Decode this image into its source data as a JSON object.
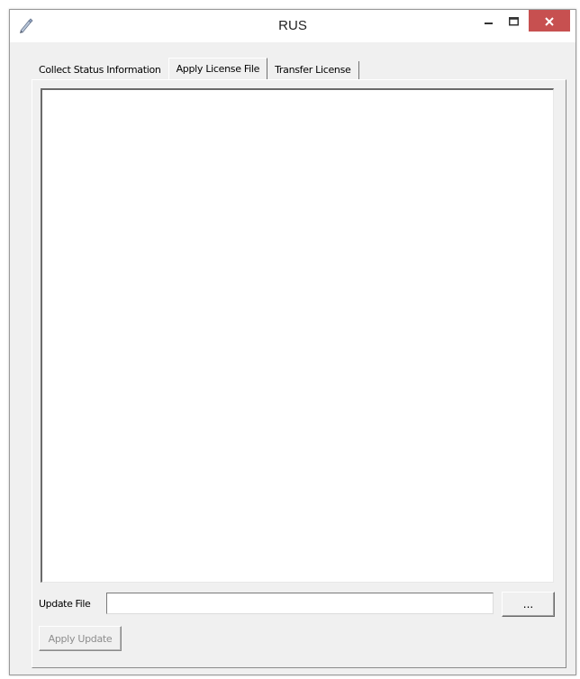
{
  "window": {
    "title": "RUS",
    "close_color": "#c75050"
  },
  "tabs": [
    {
      "label": "Collect Status Information",
      "active": false
    },
    {
      "label": "Apply License File",
      "active": true
    },
    {
      "label": "Transfer License",
      "active": false
    }
  ],
  "panel": {
    "log_text": "",
    "update_file_label": "Update File",
    "update_file_value": "",
    "browse_label": "...",
    "apply_label": "Apply Update",
    "apply_enabled": false
  },
  "icons": {
    "app": "pen-icon",
    "minimize": "minimize-icon",
    "maximize": "maximize-icon",
    "close": "close-icon"
  }
}
